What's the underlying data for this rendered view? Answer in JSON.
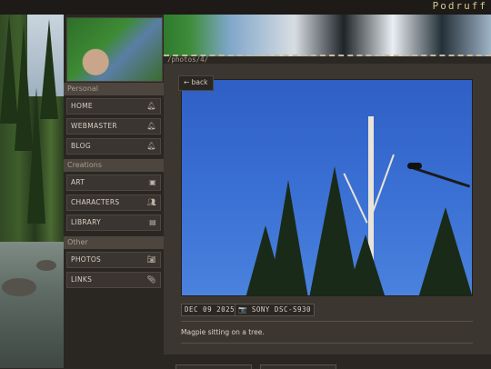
{
  "site": {
    "title": "Podruff"
  },
  "sidebar": {
    "sections": [
      {
        "label": "Personal",
        "items": [
          {
            "label": "HOME",
            "icon": "bell-icon"
          },
          {
            "label": "WEBMASTER",
            "icon": "bell-icon"
          },
          {
            "label": "BLOG",
            "icon": "bell-icon"
          }
        ]
      },
      {
        "label": "Creations",
        "items": [
          {
            "label": "ART",
            "icon": "image-icon"
          },
          {
            "label": "CHARACTERS",
            "icon": "users-icon"
          },
          {
            "label": "LIBRARY",
            "icon": "book-icon"
          }
        ]
      },
      {
        "label": "Other",
        "items": [
          {
            "label": "PHOTOS",
            "icon": "camera-icon"
          },
          {
            "label": "LINKS",
            "icon": "paperclip-icon"
          }
        ]
      }
    ]
  },
  "content": {
    "path": "/photos/4/",
    "back_label": "← back",
    "date": "DEC 09 2025",
    "camera": "📷 SONY DSC-S930",
    "caption": "Magpie sitting on a tree."
  }
}
